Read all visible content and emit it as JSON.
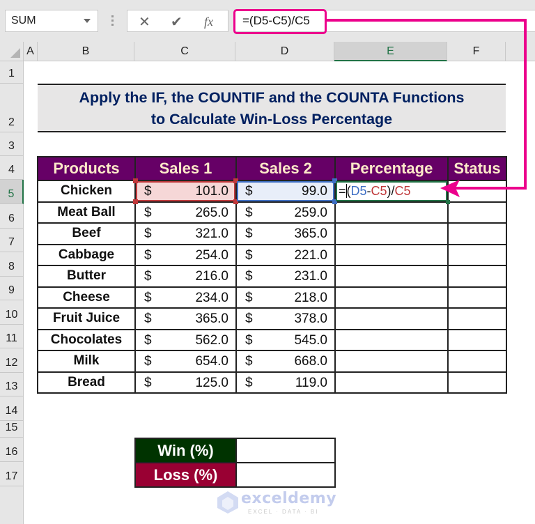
{
  "formula_bar": {
    "name_box": "SUM",
    "cancel_icon": "✕",
    "enter_icon": "✔",
    "fx_label": "fx",
    "formula": "=(D5-C5)/C5"
  },
  "columns": [
    "A",
    "B",
    "C",
    "D",
    "E",
    "F"
  ],
  "selected_column": "E",
  "rows": [
    "1",
    "2",
    "3",
    "4",
    "5",
    "6",
    "7",
    "8",
    "9",
    "10",
    "11",
    "12",
    "13",
    "14",
    "15",
    "16",
    "17"
  ],
  "selected_row": "5",
  "title_lines": [
    "Apply the IF, the COUNTIF and the COUNTA Functions",
    "to Calculate Win-Loss Percentage"
  ],
  "table": {
    "headers": [
      "Products",
      "Sales 1",
      "Sales 2",
      "Percentage",
      "Status"
    ],
    "currency_symbol": "$",
    "rows": [
      {
        "product": "Chicken",
        "sales1": "101.0",
        "sales2": "99.0"
      },
      {
        "product": "Meat Ball",
        "sales1": "265.0",
        "sales2": "259.0"
      },
      {
        "product": "Beef",
        "sales1": "321.0",
        "sales2": "365.0"
      },
      {
        "product": "Cabbage",
        "sales1": "254.0",
        "sales2": "221.0"
      },
      {
        "product": "Butter",
        "sales1": "216.0",
        "sales2": "231.0"
      },
      {
        "product": "Cheese",
        "sales1": "234.0",
        "sales2": "218.0"
      },
      {
        "product": "Fruit Juice",
        "sales1": "365.0",
        "sales2": "378.0"
      },
      {
        "product": "Chocolates",
        "sales1": "562.0",
        "sales2": "545.0"
      },
      {
        "product": "Milk",
        "sales1": "654.0",
        "sales2": "668.0"
      },
      {
        "product": "Bread",
        "sales1": "125.0",
        "sales2": "119.0"
      }
    ],
    "editing_cell": {
      "eq": "=",
      "open": "(",
      "ref1": "D5",
      "minus": "-",
      "ref2": "C5",
      "close_div": ")/",
      "ref3": "C5"
    }
  },
  "summary": {
    "win_label": "Win (%)",
    "loss_label": "Loss (%)",
    "win_value": "",
    "loss_value": ""
  },
  "watermark": {
    "name": "exceldemy",
    "tagline": "EXCEL · DATA · BI"
  },
  "colors": {
    "highlight": "#ec008c",
    "header_bg": "#660066",
    "title_text": "#002060",
    "win_bg": "#003300",
    "loss_bg": "#990033",
    "excel_green": "#217346"
  }
}
